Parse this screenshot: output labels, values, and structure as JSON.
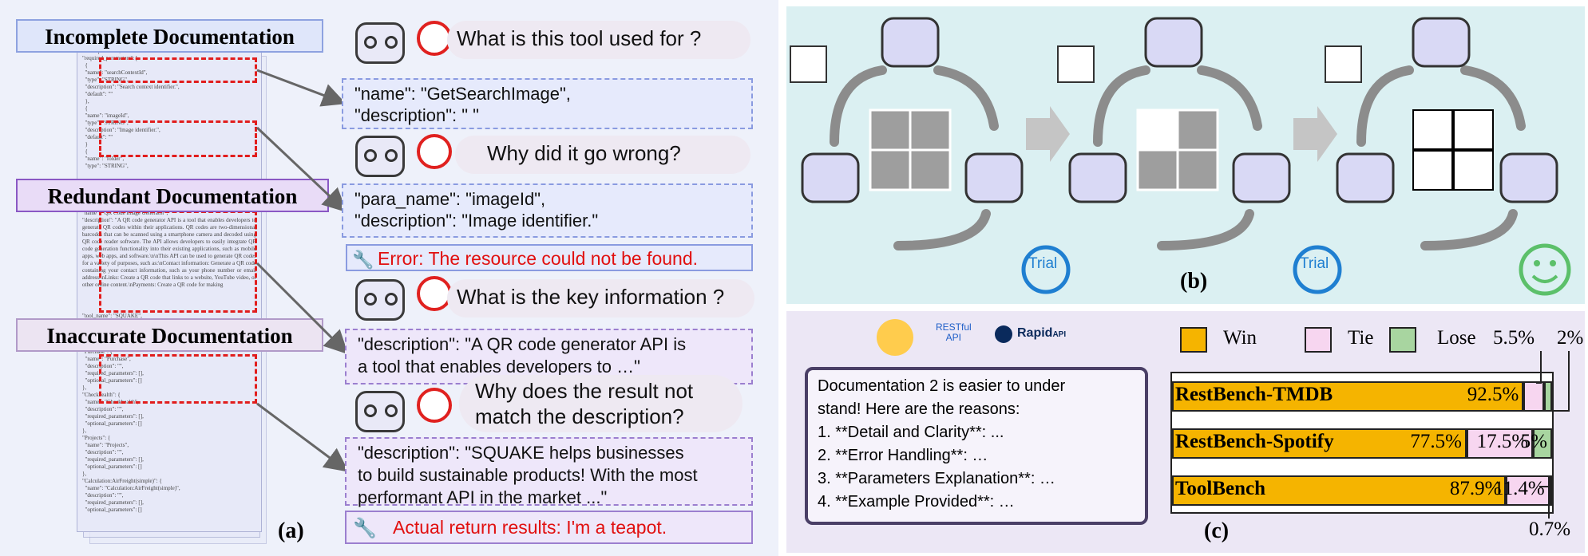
{
  "panel_a": {
    "label": "(a)",
    "doc_titles": [
      "Incomplete Documentation",
      "Redundant Documentation",
      "Inaccurate Documentation"
    ],
    "questions": [
      "What is this tool used for ?",
      "Why did it go wrong?",
      "What is the key information ?",
      "Why does the result not\nmatch the description?"
    ],
    "snippets": [
      "\"name\": \"GetSearchImage\",\n\"description\": \" \"",
      "\"para_name\": \"imageId\",\n\"description\": \"Image identifier.\"",
      "\"description\": \"A QR code generator API is\na tool that enables developers to  …\"",
      "\"description\": \"SQUAKE helps businesses\nto build sustainable products! With the most\nperformant API in the market ...\""
    ],
    "errors": [
      "Error: The resource could not be found.",
      "Actual return results: I'm a teapot."
    ],
    "doc_text_1": "\"description\": \"\",\n\"required_parameters\": [\n  {\n  \"name\": \"searchContextId\",\n  \"type\": \"STRING\",\n  \"description\": \"Search context identifier.\",\n  \"default\": \"\"\n  },\n  {\n  \"name\": \"imageId\",\n  \"type\": \"STRING\",\n  \"description\": \"Image identifier.\",\n  \"default\": \"\"\n  }\n  {\n  \"name\": \"folder\",\n  \"type\": \"STRING\",",
    "doc_text_2": "\"name\": \"QR Code Image Generator\",\n\"description\": \"A QR code generator API is a tool that enables developers to generate QR codes within their applications. QR codes are two-dimensional barcodes that can be scanned using a smartphone camera and decoded using QR code reader software. The API allows developers to easily integrate QR code generation functionality into their existing applications, such as mobile apps, web apps, and software.\\n\\nThis API can be used to generate QR codes for a variety of purposes, such as:\\nContact information: Generate a QR code containing your contact information, such as your phone number or email address.\\nLinks: Create a QR code that links to a website, YouTube video, or other online content.\\nPayments: Create a QR code for making",
    "doc_text_3": "\"tool_name\": \"SQUAKE\",\n\"tool_description\": \"SQUAKE helps businesses to build sustainable products! With the most performant API in the market, we help travel, mobility, and logistics companies calculate carbon emissions and purchase certified climate contributions in real-time. Implemented within\n\"Purchase\": {\n  \"name\": \"Purchase\",\n  \"description\": \"\",\n  \"required_parameters\": [],\n  \"optional_parameters\": []\n},\n\"Checkhealth\": {\n  \"name\": \"Checkhealth\",\n  \"description\": \"\",\n  \"required_parameters\": [],\n  \"optional_parameters\": []\n},\n\"Projects\": {\n  \"name\": \"Projects\",\n  \"description\": \"\",\n  \"required_parameters\": [],\n  \"optional_parameters\": []\n},\n\"Calculation:AirFreight(simple)\": {\n  \"name\": \"Calculation:AirFreight(simple)\",\n  \"description\": \"\",\n  \"required_parameters\": [],\n  \"optional_parameters\": []"
  },
  "panel_b": {
    "label": "(b)",
    "trial_labels": [
      "Trial",
      "Trial"
    ]
  },
  "panel_c": {
    "label": "(c)",
    "logos": [
      "RESTful\nAPI",
      "Rapid",
      "API"
    ],
    "chat_lines": [
      "Documentation 2 is easier to under",
      "stand! Here are the reasons:",
      "1. **Detail and Clarity**: ...",
      "2. **Error Handling**: …",
      "3. **Parameters Explanation**: …",
      "4. **Example Provided**:  …"
    ],
    "legend": [
      "Win",
      "Tie",
      "Lose"
    ],
    "colors": {
      "win": "#f5b400",
      "tie": "#f7d6f0",
      "lose": "#a8d5a0"
    },
    "outside_labels": [
      "5.5%",
      "2%",
      "0.7%"
    ]
  },
  "chart_data": {
    "type": "bar",
    "orientation": "horizontal",
    "stacked": true,
    "categories": [
      "RestBench-TMDB",
      "RestBench-Spotify",
      "ToolBench"
    ],
    "series": [
      {
        "name": "Win",
        "values": [
          92.5,
          77.5,
          87.9
        ]
      },
      {
        "name": "Tie",
        "values": [
          5.5,
          17.5,
          11.4
        ]
      },
      {
        "name": "Lose",
        "values": [
          2,
          5,
          0.7
        ]
      }
    ],
    "data_labels": [
      [
        "92.5%",
        "",
        ""
      ],
      [
        "77.5%",
        "17.5%",
        "5%"
      ],
      [
        "87.9%",
        "11.4%",
        ""
      ]
    ],
    "xlim": [
      0,
      100
    ],
    "legend_position": "top"
  }
}
